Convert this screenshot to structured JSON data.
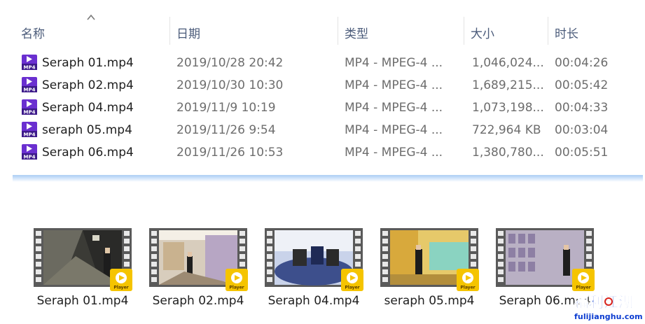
{
  "columns": {
    "name": "名称",
    "date": "日期",
    "type": "类型",
    "size": "大小",
    "duration": "时长"
  },
  "files": [
    {
      "name": "Seraph 01.mp4",
      "date": "2019/10/28 20:42",
      "type": "MP4 - MPEG-4 ...",
      "size": "1,046,024...",
      "duration": "00:04:26"
    },
    {
      "name": "Seraph 02.mp4",
      "date": "2019/10/30 10:30",
      "type": "MP4 - MPEG-4 ...",
      "size": "1,689,215...",
      "duration": "00:05:42"
    },
    {
      "name": "Seraph 04.mp4",
      "date": "2019/11/9 10:19",
      "type": "MP4 - MPEG-4 ...",
      "size": "1,073,198...",
      "duration": "00:04:33"
    },
    {
      "name": "seraph 05.mp4",
      "date": "2019/11/26 9:54",
      "type": "MP4 - MPEG-4 ...",
      "size": "722,964 KB",
      "duration": "00:03:04"
    },
    {
      "name": "Seraph 06.mp4",
      "date": "2019/11/26 10:53",
      "type": "MP4 - MPEG-4 ...",
      "size": "1,380,780...",
      "duration": "00:05:51"
    }
  ],
  "thumbnails": [
    {
      "label": "Seraph 01.mp4"
    },
    {
      "label": "Seraph 02.mp4"
    },
    {
      "label": "Seraph 04.mp4"
    },
    {
      "label": "seraph 05.mp4"
    },
    {
      "label": "Seraph 06.mp4"
    }
  ],
  "badge": {
    "text": "Player"
  },
  "icon_text": "MP4",
  "watermark": {
    "cn": "福利江湖",
    "url": "fulijianghu.com"
  },
  "colors": {
    "header_text": "#4b5b7a",
    "secondary_text": "#6d6d6d",
    "band": "#cfe3fa",
    "icon_purple": "#6a2fd0",
    "badge_yellow": "#f5c400"
  }
}
